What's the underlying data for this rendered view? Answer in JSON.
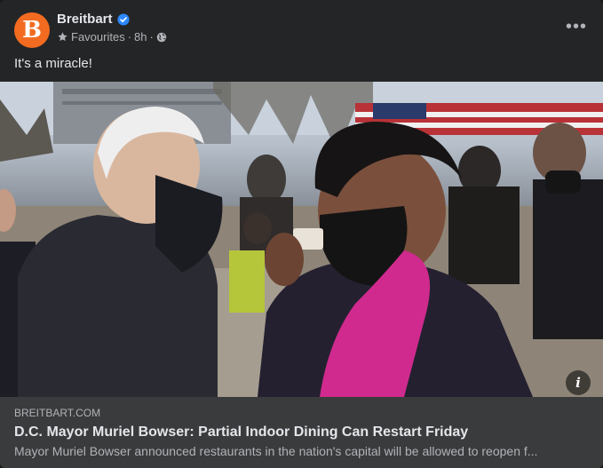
{
  "post": {
    "page_name": "Breitbart",
    "avatar_letter": "B",
    "audience": "Favourites",
    "separator": "·",
    "timestamp": "8h",
    "more_label": "•••",
    "caption": "It's a miracle!"
  },
  "photo": {
    "info_label": "i"
  },
  "link": {
    "domain": "BREITBART.COM",
    "title": "D.C. Mayor Muriel Bowser: Partial Indoor Dining Can Restart Friday",
    "description": "Mayor Muriel Bowser announced restaurants in the nation's capital will be allowed to reopen f..."
  },
  "colors": {
    "card_background": "#242526",
    "link_background": "#3a3b3c",
    "brand_orange": "#f26b21",
    "verified_blue": "#2d88ff",
    "primary_text": "#e4e6eb",
    "secondary_text": "#b0b3b8"
  }
}
